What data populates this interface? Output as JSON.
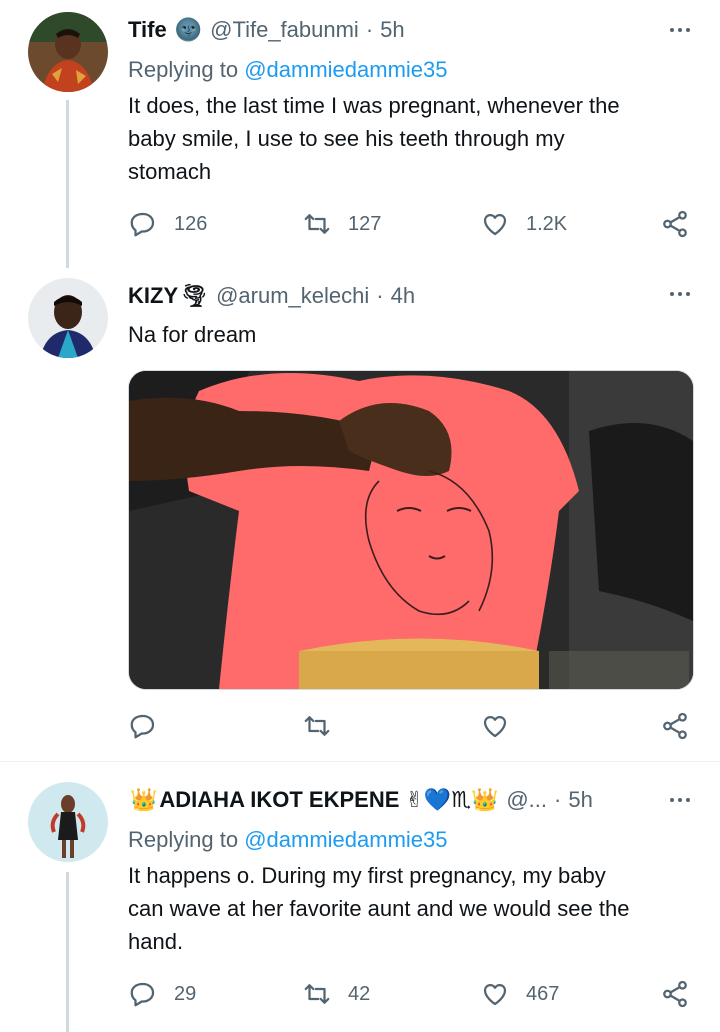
{
  "tweets": [
    {
      "name": "Tife",
      "name_emoji": "🌚",
      "handle": "@Tife_fabunmi",
      "dot": "·",
      "time": "5h",
      "replying_label": "Replying to",
      "replying_to": "@dammiedammie35",
      "text": "It does, the last time I was pregnant, whenever the\nbaby smile, I use to see his teeth through my\nstomach",
      "replies": "126",
      "retweets": "127",
      "likes": "1.2K"
    },
    {
      "name": "KIZY",
      "name_emoji": "🌪",
      "handle": "@arum_kelechi",
      "dot": "·",
      "time": "4h",
      "text": "Na for dream"
    },
    {
      "name_prefix_emoji": "👑",
      "name": "ADIAHA IKOT EKPENE",
      "name_emojis": "✌💙♏👑",
      "handle": "@...",
      "dot": "·",
      "time": "5h",
      "replying_label": "Replying to",
      "replying_to": "@dammiedammie35",
      "text": "It happens o.  During my first pregnancy, my baby\ncan wave at her favorite aunt and we would see the\nhand.",
      "replies": "29",
      "retweets": "42",
      "likes": "467"
    }
  ],
  "icons": {
    "reply": "reply-icon",
    "retweet": "retweet-icon",
    "like": "heart-icon",
    "share": "share-icon",
    "more": "more-icon"
  },
  "colors": {
    "link": "#1d9bf0",
    "secondary": "#536471",
    "thread_line": "#cfd9de"
  }
}
